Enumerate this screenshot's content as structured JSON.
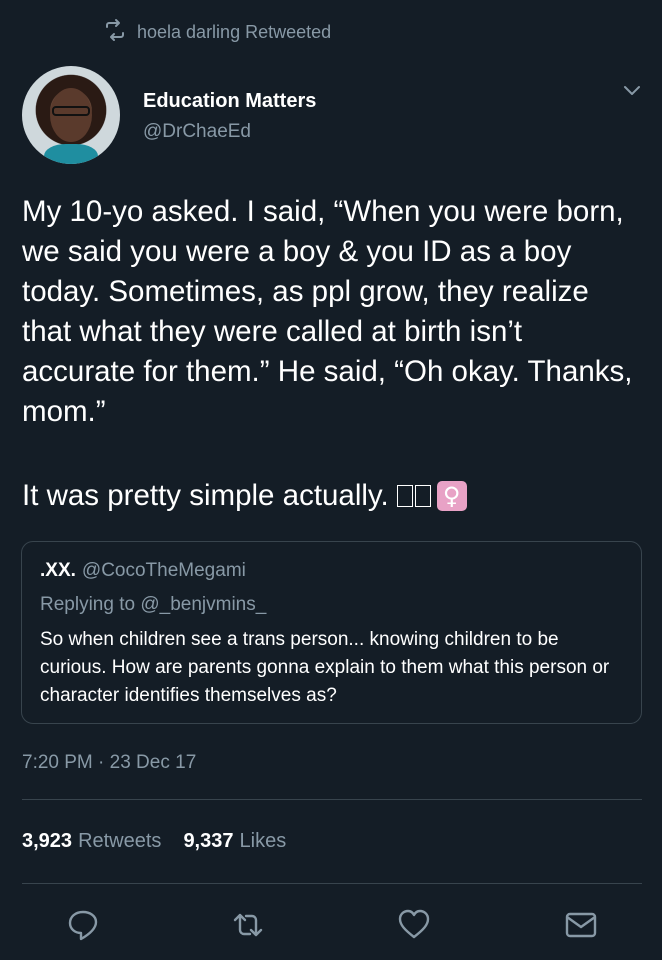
{
  "retweet": {
    "icon": "retweet-icon",
    "text": "hoela darling Retweeted"
  },
  "author": {
    "name": "Education Matters",
    "handle": "@DrChaeEd",
    "avatar_icon": "profile-photo"
  },
  "tweet": {
    "text": "My 10-yo asked. I said, “When you were born, we said you were a boy & you ID as a boy today. Sometimes, as ppl grow, they realize that what they were called at birth isn’t accurate for them.” He said, “Oh okay. Thanks, mom.”",
    "text2": "It was pretty simple actually."
  },
  "quote": {
    "name": ".XX.",
    "handle": "@CocoTheMegami",
    "replying": "Replying to @_benjvmins_",
    "text": "So when children see a trans person... knowing children to be curious. How are parents gonna explain to them what this person or character identifies themselves as?"
  },
  "timestamp": "7:20 PM · 23 Dec 17",
  "stats": {
    "retweets_count": "3,923",
    "retweets_label": "Retweets",
    "likes_count": "9,337",
    "likes_label": "Likes"
  },
  "colors": {
    "background": "#141d26",
    "muted": "#8899a6",
    "border": "#38444d"
  }
}
